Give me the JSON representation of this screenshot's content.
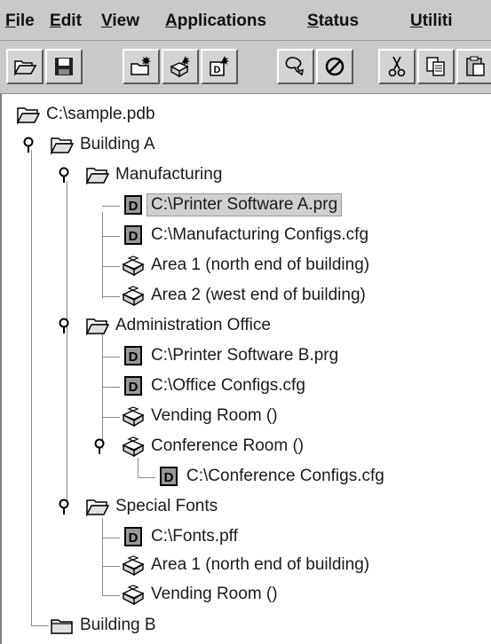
{
  "menubar": {
    "items": [
      {
        "u": "F",
        "rest": "ile"
      },
      {
        "u": "E",
        "rest": "dit"
      },
      {
        "u": "V",
        "rest": "iew"
      },
      {
        "u": "A",
        "rest": "pplications"
      },
      {
        "u": "S",
        "rest": "tatus"
      },
      {
        "u": "U",
        "rest": "tiliti"
      }
    ]
  },
  "toolbar": {
    "buttons": [
      "open-icon",
      "save-icon",
      "new-folder-icon",
      "new-area-icon",
      "new-document-icon",
      "lasso-icon",
      "cancel-icon",
      "cut-icon",
      "copy-icon",
      "paste-icon"
    ]
  },
  "tree": {
    "root": "C:\\sample.pdb",
    "building_a": "Building A",
    "manufacturing": "Manufacturing",
    "mfg_printer_sw": "C:\\Printer Software A.prg",
    "mfg_configs": "C:\\Manufacturing Configs.cfg",
    "mfg_area1": "Area 1 (north end of building)",
    "mfg_area2": "Area 2 (west end of building)",
    "admin_office": "Administration Office",
    "admin_printer_sw": "C:\\Printer Software B.prg",
    "admin_configs": "C:\\Office Configs.cfg",
    "admin_vending": "Vending Room ()",
    "admin_conference": "Conference Room ()",
    "conf_configs": "C:\\Conference Configs.cfg",
    "special_fonts": "Special Fonts",
    "fonts_file": "C:\\Fonts.pff",
    "fonts_area1": "Area 1 (north end of building)",
    "fonts_vending": "Vending Room ()",
    "building_b": "Building B"
  }
}
